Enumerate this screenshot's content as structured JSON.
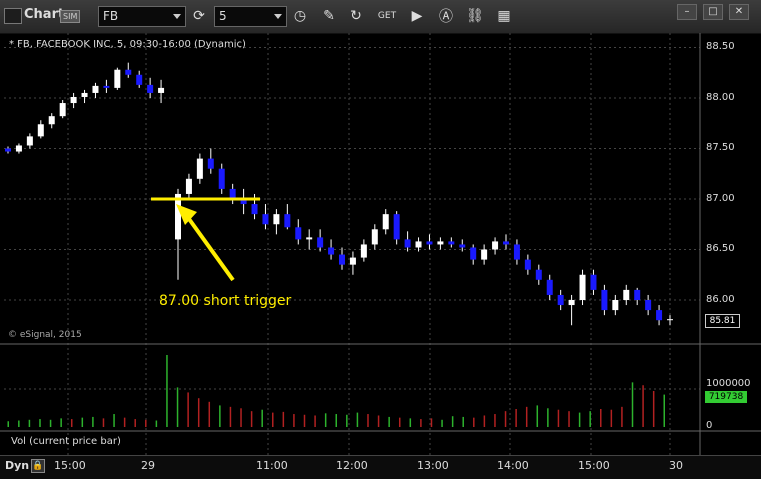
{
  "toolbar": {
    "title": "Chart",
    "sim_badge": "SIM",
    "symbol": "FB",
    "interval": "5",
    "icons": [
      "refresh-icon",
      "clock-icon",
      "pencil-icon",
      "link-icon",
      "get-icon",
      "play-icon",
      "a-icon",
      "chain-icon",
      "grid-icon"
    ]
  },
  "header": {
    "text": "* FB, FACEBOOK INC, 5, 09:30-16:00 (Dynamic)"
  },
  "watermark": "© eSignal, 2015",
  "price_axis": [
    "88.50",
    "88.00",
    "87.50",
    "87.00",
    "86.50",
    "86.00"
  ],
  "current_price": "85.81",
  "volume_axis": [
    "1000000",
    "0"
  ],
  "current_volume": "719738",
  "volume_label": "Vol (current price bar)",
  "time_axis": [
    "15:00",
    "29",
    "11:00",
    "12:00",
    "13:00",
    "14:00",
    "15:00",
    "30"
  ],
  "bottom": {
    "mode": "Dyn"
  },
  "annotation": "87.00 short trigger",
  "colors": {
    "up": "#ffffff",
    "down": "#1a1aff",
    "trigger": "#ffee00",
    "vol_up": "#2db32d",
    "vol_down": "#b32121"
  },
  "chart_data": {
    "type": "candlestick",
    "symbol": "FB",
    "trigger_level": 87.0,
    "ylim": [
      85.7,
      88.7
    ],
    "candles": [
      [
        87.5,
        87.52,
        87.45,
        87.47
      ],
      [
        87.47,
        87.55,
        87.45,
        87.53
      ],
      [
        87.53,
        87.65,
        87.5,
        87.62
      ],
      [
        87.62,
        87.78,
        87.6,
        87.74
      ],
      [
        87.74,
        87.85,
        87.7,
        87.82
      ],
      [
        87.82,
        87.98,
        87.8,
        87.95
      ],
      [
        87.95,
        88.05,
        87.9,
        88.01
      ],
      [
        88.01,
        88.08,
        87.95,
        88.05
      ],
      [
        88.05,
        88.15,
        88.0,
        88.12
      ],
      [
        88.12,
        88.18,
        88.05,
        88.1
      ],
      [
        88.1,
        88.3,
        88.08,
        88.28
      ],
      [
        88.28,
        88.35,
        88.2,
        88.23
      ],
      [
        88.23,
        88.27,
        88.1,
        88.13
      ],
      [
        88.13,
        88.2,
        88.0,
        88.05
      ],
      [
        88.05,
        88.18,
        87.95,
        88.1
      ],
      [
        86.6,
        87.1,
        86.2,
        87.05
      ],
      [
        87.05,
        87.25,
        87.0,
        87.2
      ],
      [
        87.2,
        87.45,
        87.15,
        87.4
      ],
      [
        87.4,
        87.5,
        87.25,
        87.3
      ],
      [
        87.3,
        87.35,
        87.05,
        87.1
      ],
      [
        87.1,
        87.15,
        86.95,
        87.0
      ],
      [
        87.0,
        87.1,
        86.85,
        86.95
      ],
      [
        86.95,
        87.05,
        86.8,
        86.85
      ],
      [
        86.85,
        86.95,
        86.7,
        86.75
      ],
      [
        86.75,
        86.9,
        86.65,
        86.85
      ],
      [
        86.85,
        86.95,
        86.7,
        86.72
      ],
      [
        86.72,
        86.8,
        86.55,
        86.6
      ],
      [
        86.6,
        86.7,
        86.5,
        86.62
      ],
      [
        86.62,
        86.7,
        86.48,
        86.52
      ],
      [
        86.52,
        86.6,
        86.4,
        86.45
      ],
      [
        86.45,
        86.52,
        86.3,
        86.35
      ],
      [
        86.35,
        86.48,
        86.25,
        86.42
      ],
      [
        86.42,
        86.6,
        86.38,
        86.55
      ],
      [
        86.55,
        86.75,
        86.5,
        86.7
      ],
      [
        86.7,
        86.9,
        86.65,
        86.85
      ],
      [
        86.85,
        86.88,
        86.55,
        86.6
      ],
      [
        86.6,
        86.68,
        86.48,
        86.52
      ],
      [
        86.52,
        86.62,
        86.48,
        86.58
      ],
      [
        86.58,
        86.65,
        86.5,
        86.55
      ],
      [
        86.55,
        86.62,
        86.5,
        86.58
      ],
      [
        86.58,
        86.62,
        86.52,
        86.55
      ],
      [
        86.55,
        86.6,
        86.48,
        86.52
      ],
      [
        86.52,
        86.55,
        86.35,
        86.4
      ],
      [
        86.4,
        86.55,
        86.35,
        86.5
      ],
      [
        86.5,
        86.62,
        86.45,
        86.58
      ],
      [
        86.58,
        86.65,
        86.5,
        86.55
      ],
      [
        86.55,
        86.6,
        86.35,
        86.4
      ],
      [
        86.4,
        86.45,
        86.25,
        86.3
      ],
      [
        86.3,
        86.35,
        86.15,
        86.2
      ],
      [
        86.2,
        86.25,
        86.0,
        86.05
      ],
      [
        86.05,
        86.1,
        85.9,
        85.95
      ],
      [
        85.95,
        86.05,
        85.75,
        86.0
      ],
      [
        86.0,
        86.3,
        85.95,
        86.25
      ],
      [
        86.25,
        86.3,
        86.05,
        86.1
      ],
      [
        86.1,
        86.15,
        85.85,
        85.9
      ],
      [
        85.9,
        86.05,
        85.85,
        86.0
      ],
      [
        86.0,
        86.15,
        85.95,
        86.1
      ],
      [
        86.1,
        86.12,
        85.95,
        86.0
      ],
      [
        86.0,
        86.05,
        85.85,
        85.9
      ],
      [
        85.9,
        85.95,
        85.75,
        85.8
      ],
      [
        85.8,
        85.85,
        85.75,
        85.81
      ]
    ],
    "volumes": [
      [
        8,
        1
      ],
      [
        9,
        1
      ],
      [
        10,
        1
      ],
      [
        11,
        1
      ],
      [
        10,
        1
      ],
      [
        12,
        1
      ],
      [
        11,
        0
      ],
      [
        13,
        1
      ],
      [
        14,
        1
      ],
      [
        12,
        0
      ],
      [
        18,
        1
      ],
      [
        13,
        0
      ],
      [
        11,
        0
      ],
      [
        10,
        0
      ],
      [
        9,
        1
      ],
      [
        100,
        1
      ],
      [
        55,
        1
      ],
      [
        48,
        0
      ],
      [
        40,
        0
      ],
      [
        35,
        0
      ],
      [
        30,
        1
      ],
      [
        28,
        0
      ],
      [
        26,
        0
      ],
      [
        22,
        0
      ],
      [
        24,
        1
      ],
      [
        20,
        0
      ],
      [
        21,
        0
      ],
      [
        18,
        0
      ],
      [
        17,
        0
      ],
      [
        16,
        0
      ],
      [
        19,
        1
      ],
      [
        18,
        1
      ],
      [
        17,
        1
      ],
      [
        20,
        1
      ],
      [
        18,
        0
      ],
      [
        16,
        0
      ],
      [
        14,
        1
      ],
      [
        13,
        0
      ],
      [
        12,
        1
      ],
      [
        11,
        0
      ],
      [
        12,
        0
      ],
      [
        10,
        1
      ],
      [
        15,
        1
      ],
      [
        14,
        1
      ],
      [
        13,
        0
      ],
      [
        16,
        0
      ],
      [
        18,
        0
      ],
      [
        22,
        0
      ],
      [
        25,
        0
      ],
      [
        28,
        0
      ],
      [
        30,
        1
      ],
      [
        26,
        1
      ],
      [
        24,
        0
      ],
      [
        22,
        0
      ],
      [
        20,
        1
      ],
      [
        22,
        1
      ],
      [
        25,
        0
      ],
      [
        24,
        0
      ],
      [
        28,
        0
      ],
      [
        62,
        1
      ],
      [
        58,
        0
      ],
      [
        50,
        0
      ],
      [
        45,
        1
      ]
    ]
  }
}
